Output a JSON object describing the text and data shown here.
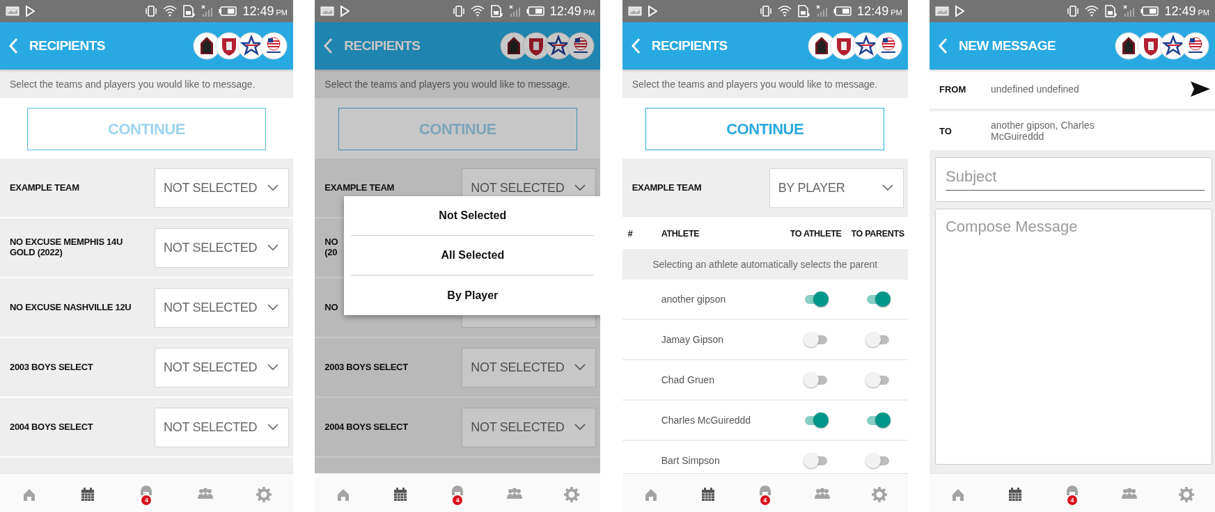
{
  "screens": [
    {
      "kind": "recipients",
      "status_bar": {
        "time": "12:49",
        "period": "PM"
      },
      "header": {
        "title": "RECIPIENTS"
      },
      "instruction": "Select the teams and players you would like to message.",
      "continue_button": {
        "label": "CONTINUE",
        "disabled": true
      },
      "teams": [
        {
          "name": "EXAMPLE TEAM",
          "value": "NOT SELECTED"
        },
        {
          "name": "NO EXCUSE MEMPHIS 14U GOLD (2022)",
          "value": "NOT SELECTED"
        },
        {
          "name": "NO EXCUSE NASHVILLE 12U",
          "value": "NOT SELECTED"
        },
        {
          "name": "2003 BOYS SELECT",
          "value": "NOT SELECTED"
        },
        {
          "name": "2004 BOYS SELECT",
          "value": "NOT SELECTED"
        }
      ],
      "nav": [
        {
          "kind": "home"
        },
        {
          "kind": "calendar"
        },
        {
          "kind": "helmet",
          "badge": "4"
        },
        {
          "kind": "group"
        },
        {
          "kind": "gear"
        }
      ]
    },
    {
      "kind": "recipients",
      "dimmed": true,
      "status_bar": {
        "time": "12:49",
        "period": "PM"
      },
      "header": {
        "title": "RECIPIENTS"
      },
      "instruction": "Select the teams and players you would like to message.",
      "continue_button": {
        "label": "CONTINUE",
        "disabled": true
      },
      "teams": [
        {
          "name": "EXAMPLE TEAM",
          "value": "NOT SELECTED"
        },
        {
          "name": "NO\n(20"
        },
        {
          "name": "NO"
        },
        {
          "name": "2003 BOYS SELECT",
          "value": "NOT SELECTED"
        },
        {
          "name": "2004 BOYS SELECT",
          "value": "NOT SELECTED"
        }
      ],
      "dialog": {
        "options": [
          "Not Selected",
          "All Selected",
          "By Player"
        ]
      },
      "nav": [
        {
          "kind": "home"
        },
        {
          "kind": "calendar"
        },
        {
          "kind": "helmet",
          "badge": "4"
        },
        {
          "kind": "group"
        },
        {
          "kind": "gear"
        }
      ]
    },
    {
      "kind": "recipients",
      "status_bar": {
        "time": "12:49",
        "period": "PM"
      },
      "header": {
        "title": "RECIPIENTS"
      },
      "instruction": "Select the teams and players you would like to message.",
      "continue_button": {
        "label": "CONTINUE",
        "disabled": false
      },
      "teams": [
        {
          "name": "EXAMPLE TEAM",
          "value": "BY PLAYER"
        }
      ],
      "athlete_table": {
        "columns": [
          "#",
          "ATHLETE",
          "TO ATHLETE",
          "TO PARENTS"
        ],
        "note": "Selecting an athlete automatically selects the parent",
        "rows": [
          {
            "athlete": "another gipson",
            "to_athlete": true,
            "to_parents": true
          },
          {
            "athlete": "Jamay Gipson",
            "to_athlete": false,
            "to_parents": false
          },
          {
            "athlete": "Chad Gruen",
            "to_athlete": false,
            "to_parents": false
          },
          {
            "athlete": "Charles McGuireddd",
            "to_athlete": true,
            "to_parents": true
          },
          {
            "athlete": "Bart Simpson",
            "to_athlete": false,
            "to_parents": false
          }
        ]
      },
      "nav": [
        {
          "kind": "home"
        },
        {
          "kind": "calendar"
        },
        {
          "kind": "helmet",
          "badge": "4"
        },
        {
          "kind": "group"
        },
        {
          "kind": "gear"
        }
      ]
    },
    {
      "kind": "new_message",
      "status_bar": {
        "time": "12:49",
        "period": "PM"
      },
      "header": {
        "title": "NEW MESSAGE"
      },
      "from": {
        "label": "FROM",
        "value": "undefined undefined"
      },
      "to": {
        "label": "TO",
        "value": "another gipson, Charles McGuireddd"
      },
      "subject": {
        "placeholder": "Subject"
      },
      "message": {
        "placeholder": "Compose Message"
      },
      "nav": [
        {
          "kind": "home"
        },
        {
          "kind": "calendar"
        },
        {
          "kind": "helmet",
          "badge": "4"
        },
        {
          "kind": "group"
        },
        {
          "kind": "gear"
        }
      ]
    }
  ]
}
